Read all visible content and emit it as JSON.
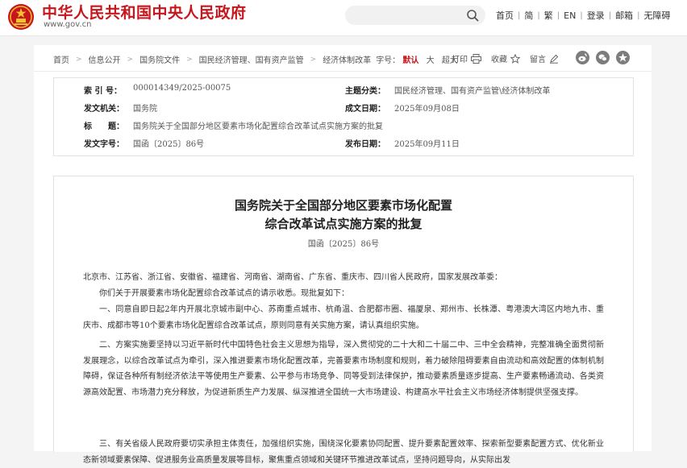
{
  "header": {
    "site_title": "中华人民共和国中央人民政府",
    "site_url": "www.gov.cn",
    "search_placeholder": "",
    "nav": [
      "首页",
      "简",
      "繁",
      "EN",
      "登录",
      "邮箱",
      "无障碍"
    ]
  },
  "breadcrumb": {
    "items": [
      "首页",
      "信息公开",
      "国务院文件",
      "国民经济管理、国有资产监管",
      "经济体制改革"
    ],
    "font_label": "字号：",
    "font_options": [
      "默认",
      "大",
      "超大"
    ],
    "font_active": "默认"
  },
  "tools": {
    "print": "打印",
    "favorite": "收藏",
    "comment": "留言"
  },
  "share_icons": [
    "weibo-icon",
    "wechat-icon",
    "qzone-icon"
  ],
  "meta": {
    "index_key": "索 引 号：",
    "index_value": "000014349/2025-00075",
    "category_key": "主题分类：",
    "category_value": "国民经济管理、国有资产监管\\经济体制改革",
    "issuer_key": "发文机关：",
    "issuer_value": "国务院",
    "date_key": "成文日期：",
    "date_value": "2025年09月08日",
    "title_key": "标　　题：",
    "title_value": "国务院关于全国部分地区要素市场化配置综合改革试点实施方案的批复",
    "docno_key": "发文字号：",
    "docno_value": "国函〔2025〕86号",
    "pubdate_key": "发布日期：",
    "pubdate_value": "2025年09月11日"
  },
  "article": {
    "title_line1": "国务院关于全国部分地区要素市场化配置",
    "title_line2": "综合改革试点实施方案的批复",
    "doc_number": "国函〔2025〕86号",
    "recipients": "北京市、江苏省、浙江省、安徽省、福建省、河南省、湖南省、广东省、重庆市、四川省人民政府，国家发展改革委：",
    "p1": "你们关于开展要素市场化配置综合改革试点的请示收悉。现批复如下：",
    "p2": "一、同意自即日起2年内开展北京城市副中心、苏南重点城市、杭甬温、合肥都市圈、福厦泉、郑州市、长株潭、粤港澳大湾区内地九市、重庆市、成都市等10个要素市场化配置综合改革试点，原则同意有关实施方案，请认真组织实施。",
    "p3": "二、方案实施要坚持以习近平新时代中国特色社会主义思想为指导，深入贯彻党的二十大和二十届二中、三中全会精神，完整准确全面贯彻新发展理念，以综合改革试点为牵引，深入推进要素市场化配置改革，完善要素市场制度和规则，着力破除阻碍要素自由流动和高效配置的体制机制障碍，保证各种所有制经济依法平等使用生产要素、公平参与市场竞争、同等受到法律保护，推动要素质量逐步提高、生产要素畅通流动、各类资源高效配置、市场潜力充分释放，为促进新质生产力发展、纵深推进全国统一大市场建设、构建高水平社会主义市场经济体制提供坚强支撑。",
    "p4": "三、有关省级人民政府要切实承担主体责任，加强组织实施，围绕深化要素协同配置、提升要素配置效率、探索新型要素配置方式、优化新业态新领域要素保障、促进服务业高质量发展等目标，聚焦重点领域和关键环节推进改革试点，坚持问题导向，从实际出发"
  }
}
